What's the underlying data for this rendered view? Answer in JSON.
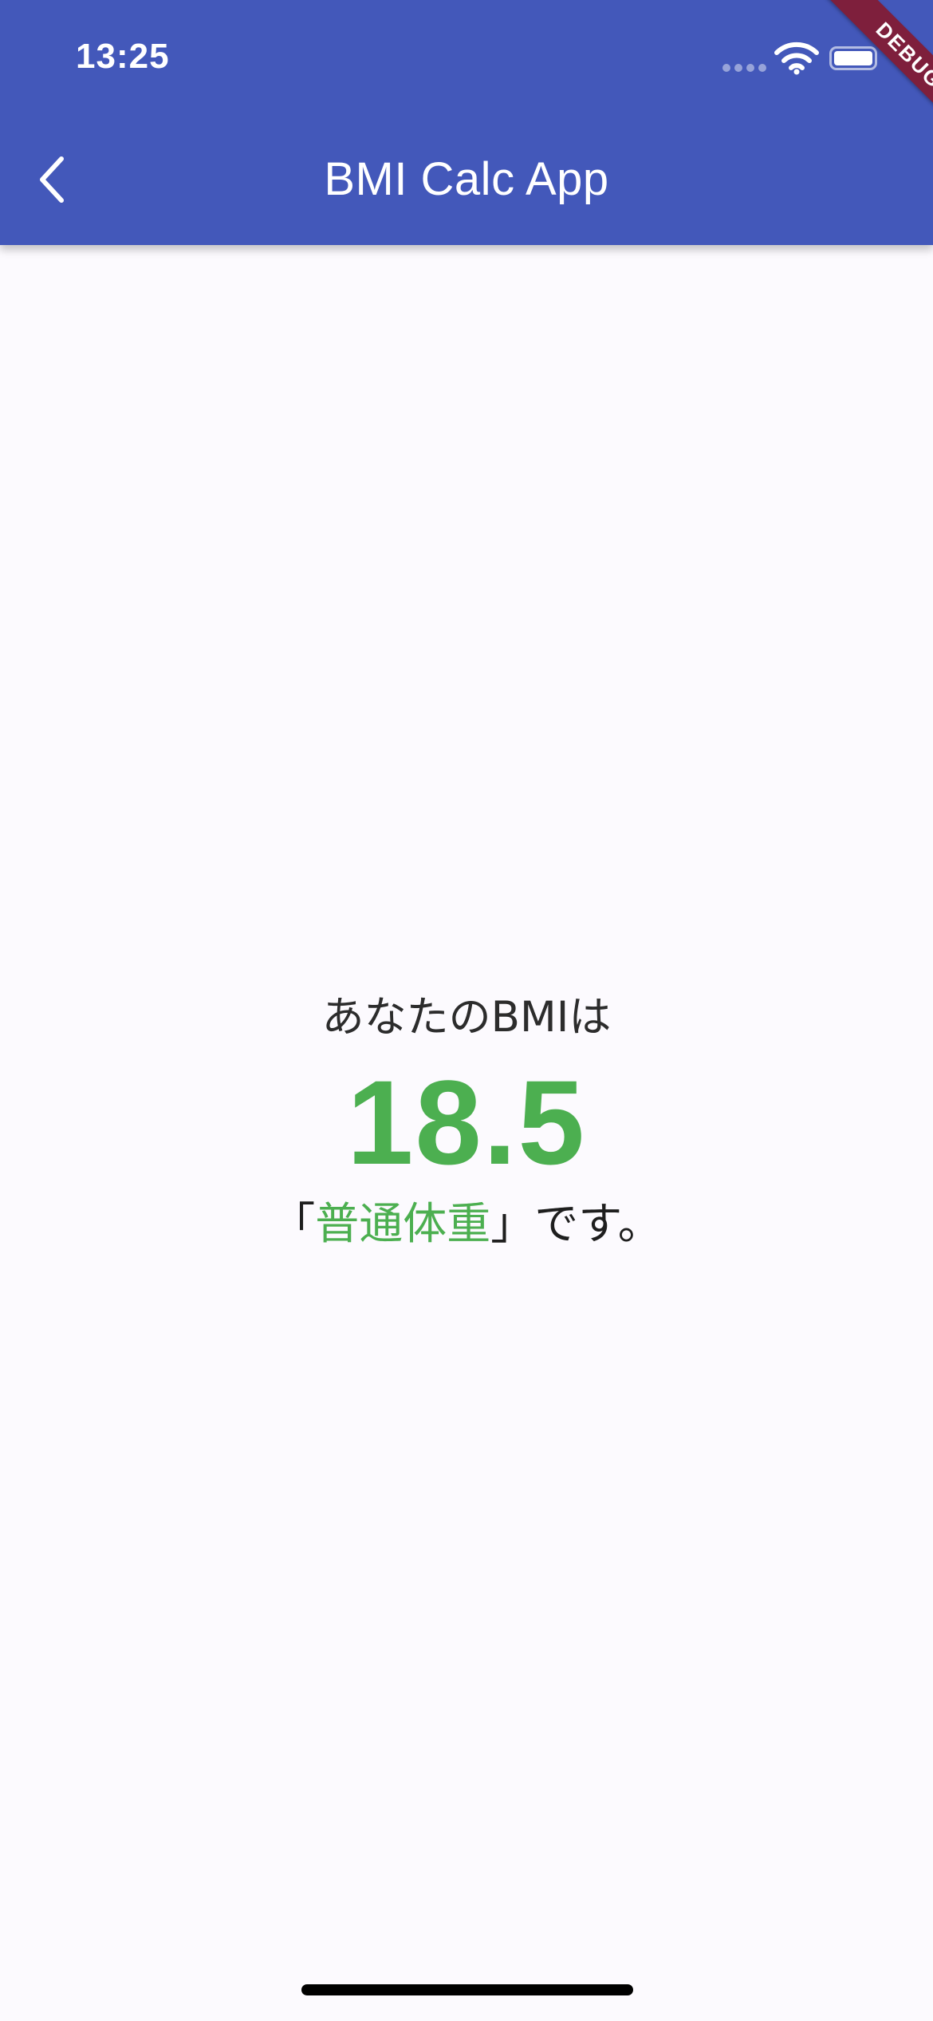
{
  "status_bar": {
    "time": "13:25"
  },
  "app_bar": {
    "title": "BMI Calc App",
    "back_icon": "chevron-left-icon",
    "color": "#4358BA"
  },
  "debug_banner": {
    "label": "DEBUG",
    "color": "#7E1F3C"
  },
  "result": {
    "lead_text": "あなたのBMIは",
    "bmi_value": "18.5",
    "category_open": "「",
    "category": "普通体重",
    "category_close": "」です。",
    "accent_color": "#4CAF50"
  }
}
